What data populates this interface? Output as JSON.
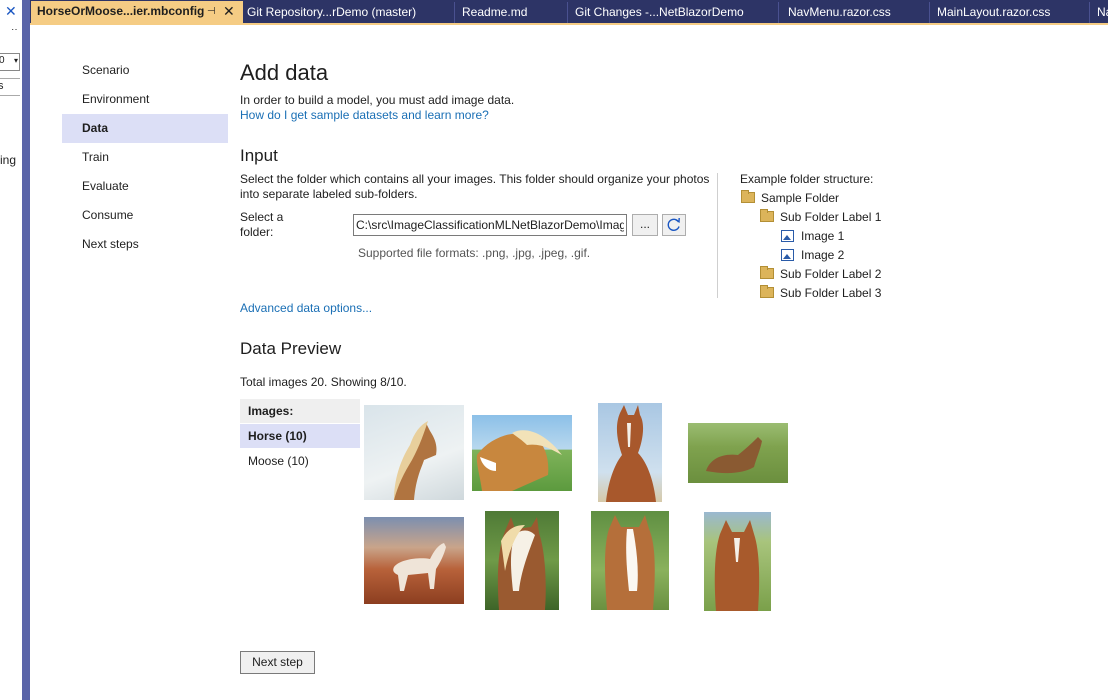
{
  "left_strip": {
    "close_glyph": "✕",
    "more_glyph": "‥",
    "dropdown_value": "0",
    "input_value": "s",
    "truncated_text": "ing"
  },
  "tabs": [
    {
      "label": "HorseOrMoose...ier.mbconfig",
      "active": true
    },
    {
      "label": "Git Repository...rDemo (master)",
      "active": false
    },
    {
      "label": "Readme.md",
      "active": false
    },
    {
      "label": "Git Changes -...NetBlazorDemo",
      "active": false
    },
    {
      "label": "NavMenu.razor.css",
      "active": false
    },
    {
      "label": "MainLayout.razor.css",
      "active": false
    },
    {
      "label": "Na",
      "active": false
    }
  ],
  "nav": {
    "items": [
      {
        "label": "Scenario"
      },
      {
        "label": "Environment"
      },
      {
        "label": "Data",
        "selected": true
      },
      {
        "label": "Train"
      },
      {
        "label": "Evaluate"
      },
      {
        "label": "Consume"
      },
      {
        "label": "Next steps"
      }
    ]
  },
  "main": {
    "title": "Add data",
    "intro": "In order to build a model, you must add image data.",
    "sample_link": "How do I get sample datasets and learn more?",
    "input": {
      "heading": "Input",
      "description_line1": "Select the folder which contains all your images. This folder should organize your photos",
      "description_line2": "into separate labeled sub-folders.",
      "folder_label_line1": "Select a",
      "folder_label_line2": "folder:",
      "folder_value": "C:\\src\\ImageClassificationMLNetBlazorDemo\\Images",
      "browse_label": "...",
      "formats": "Supported file formats: .png, .jpg, .jpeg, .gif."
    },
    "example": {
      "heading": "Example folder structure:",
      "tree": [
        {
          "label": "Sample Folder",
          "icon": "folder-icon"
        },
        {
          "label": "Sub Folder Label 1",
          "icon": "folder-icon"
        },
        {
          "label": "Image 1",
          "icon": "image-icon"
        },
        {
          "label": "Image 2",
          "icon": "image-icon"
        },
        {
          "label": "Sub Folder Label 2",
          "icon": "folder-icon"
        },
        {
          "label": "Sub Folder Label 3",
          "icon": "folder-icon"
        }
      ]
    },
    "advanced_link": "Advanced data options...",
    "preview": {
      "heading": "Data Preview",
      "summary": "Total images 20. Showing 8/10.",
      "list_header": "Images:",
      "labels": [
        {
          "label": "Horse (10)",
          "selected": true
        },
        {
          "label": "Moose (10)",
          "selected": false
        }
      ]
    },
    "next_button": "Next step"
  },
  "colors": {
    "tab_strip": "#2d3466",
    "active_tab": "#f5cc84",
    "nav_selected": "#dcdff6",
    "link": "#1a6fb5",
    "accent_bar": "#5a64a8"
  }
}
